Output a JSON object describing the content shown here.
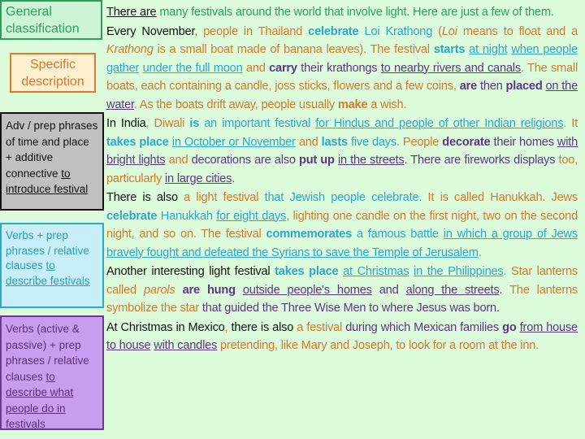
{
  "colors": {
    "background": "#dcfcdc",
    "green": "#2e9e5e",
    "orange": "#d07a30",
    "blue": "#2ea6c8",
    "purple": "#5e3584",
    "black": "#111111",
    "grey_box": "#c0c0c0"
  },
  "legend": {
    "general": "General classification",
    "specific": "Specific description",
    "adv_main": "Adv / prep phrases of time and place + additive connective ",
    "adv_purpose": "to introduce festival",
    "verbs_main": "Verbs + prep phrases / relative clauses ",
    "verbs_purpose": "to describe festivals",
    "verbs2_main": "Verbs (active & passive) + prep phrases / relative clauses ",
    "verbs2_purpose": "to describe what people do in festivals"
  },
  "paragraphs": [
    [
      [
        "There are",
        "kU"
      ],
      [
        " many festivals around the world that involve light.  Here are just a few of them.",
        "g"
      ]
    ],
    [
      [
        "Every November",
        "k"
      ],
      [
        ", people in Thailand ",
        "o"
      ],
      [
        "celebrate",
        "bB"
      ],
      [
        " Loi Krathong",
        "b"
      ],
      [
        " (",
        "o"
      ],
      [
        "Loi",
        "oI"
      ],
      [
        " means to float and a ",
        "o"
      ],
      [
        "Krathong",
        "oI"
      ],
      [
        " is a small boat made of banana leaves).  The festival ",
        "o"
      ],
      [
        "starts",
        "bB"
      ],
      [
        " ",
        "b"
      ],
      [
        "at night",
        "bU"
      ],
      [
        " ",
        "b"
      ],
      [
        "when people gather",
        "bU"
      ],
      [
        " ",
        "b"
      ],
      [
        "under the full moon",
        "bU"
      ],
      [
        " and ",
        "o"
      ],
      [
        "carry",
        "pB"
      ],
      [
        " their krathongs ",
        "p"
      ],
      [
        "to nearby rivers and canals",
        "pU"
      ],
      [
        ".  The small boats, each containing a candle, joss sticks, flowers and a few coins, ",
        "o"
      ],
      [
        "are",
        "pB"
      ],
      [
        " then ",
        "p"
      ],
      [
        "placed",
        "pB"
      ],
      [
        " ",
        "p"
      ],
      [
        "on the water",
        "pU"
      ],
      [
        ".  As the boats drift away, people usually ",
        "o"
      ],
      [
        "make",
        "oB"
      ],
      [
        " a wish.",
        "o"
      ]
    ],
    [
      [
        "In India",
        "k"
      ],
      [
        ", Diwali ",
        "o"
      ],
      [
        "is",
        "bB"
      ],
      [
        " an important festival ",
        "b"
      ],
      [
        "for Hindus and people of other Indian religions",
        "bU"
      ],
      [
        ".  It ",
        "o"
      ],
      [
        "takes place",
        "bB"
      ],
      [
        " ",
        "b"
      ],
      [
        "in October or November",
        "bU"
      ],
      [
        " and ",
        "o"
      ],
      [
        "lasts",
        "bB"
      ],
      [
        " five days.  ",
        "b"
      ],
      [
        "People ",
        "o"
      ],
      [
        "decorate",
        "pB"
      ],
      [
        " their homes ",
        "p"
      ],
      [
        "with bright lights",
        "pU"
      ],
      [
        " and ",
        "o"
      ],
      [
        "decorations are also ",
        "p"
      ],
      [
        "put up",
        "pB"
      ],
      [
        " ",
        "p"
      ],
      [
        "in the streets",
        "pU"
      ],
      [
        ".  There are fireworks displays ",
        "p"
      ],
      [
        "too, particularly ",
        "o"
      ],
      [
        "in large cities",
        "pU"
      ],
      [
        ".",
        "p"
      ]
    ],
    [
      [
        "There is also",
        "k"
      ],
      [
        " a light festival ",
        "o"
      ],
      [
        "that Jewish people celebrate.  ",
        "b"
      ],
      [
        "It is called Hanukkah.  Jews ",
        "o"
      ],
      [
        "celebrate",
        "bB"
      ],
      [
        " Hanukkah ",
        "b"
      ],
      [
        "for eight days",
        "bU"
      ],
      [
        ", lighting one candle on the first night, two on the second night, and so on.  The festival ",
        "o"
      ],
      [
        "commemorates",
        "bB"
      ],
      [
        " a famous battle ",
        "b"
      ],
      [
        "in which a group of Jews bravely fought and defeated the Syrians to save the Temple of Jerusalem",
        "bU"
      ],
      [
        ".",
        "b"
      ]
    ],
    [
      [
        "Another interesting light festival ",
        "k"
      ],
      [
        "takes place",
        "bB"
      ],
      [
        " ",
        "b"
      ],
      [
        "at Christmas",
        "bU"
      ],
      [
        " ",
        "b"
      ],
      [
        "in the Philippines",
        "bU"
      ],
      [
        ".  ",
        "b"
      ],
      [
        "Star lanterns called ",
        "o"
      ],
      [
        "parols",
        "oI"
      ],
      [
        " ",
        "o"
      ],
      [
        "are hung",
        "pB"
      ],
      [
        " ",
        "p"
      ],
      [
        "outside people's homes",
        "pU"
      ],
      [
        " and ",
        "p"
      ],
      [
        "along the streets",
        "pU"
      ],
      [
        ".  ",
        "p"
      ],
      [
        "The lanterns symbolize the star ",
        "o"
      ],
      [
        "that guided the Three Wise Men to where Jesus was born.",
        "p"
      ]
    ],
    [
      [
        "At Christmas in Mexico",
        "k"
      ],
      [
        ", ",
        "o"
      ],
      [
        "there is also ",
        "k"
      ],
      [
        "a festival ",
        "o"
      ],
      [
        "during which Mexican families ",
        "p"
      ],
      [
        "go",
        "pB"
      ],
      [
        " ",
        "p"
      ],
      [
        "from house to house",
        "pU"
      ],
      [
        " ",
        "p"
      ],
      [
        "with candles",
        "pU"
      ],
      [
        " pretending, like Mary and Joseph, to look for a room at the inn.",
        "o"
      ]
    ]
  ]
}
